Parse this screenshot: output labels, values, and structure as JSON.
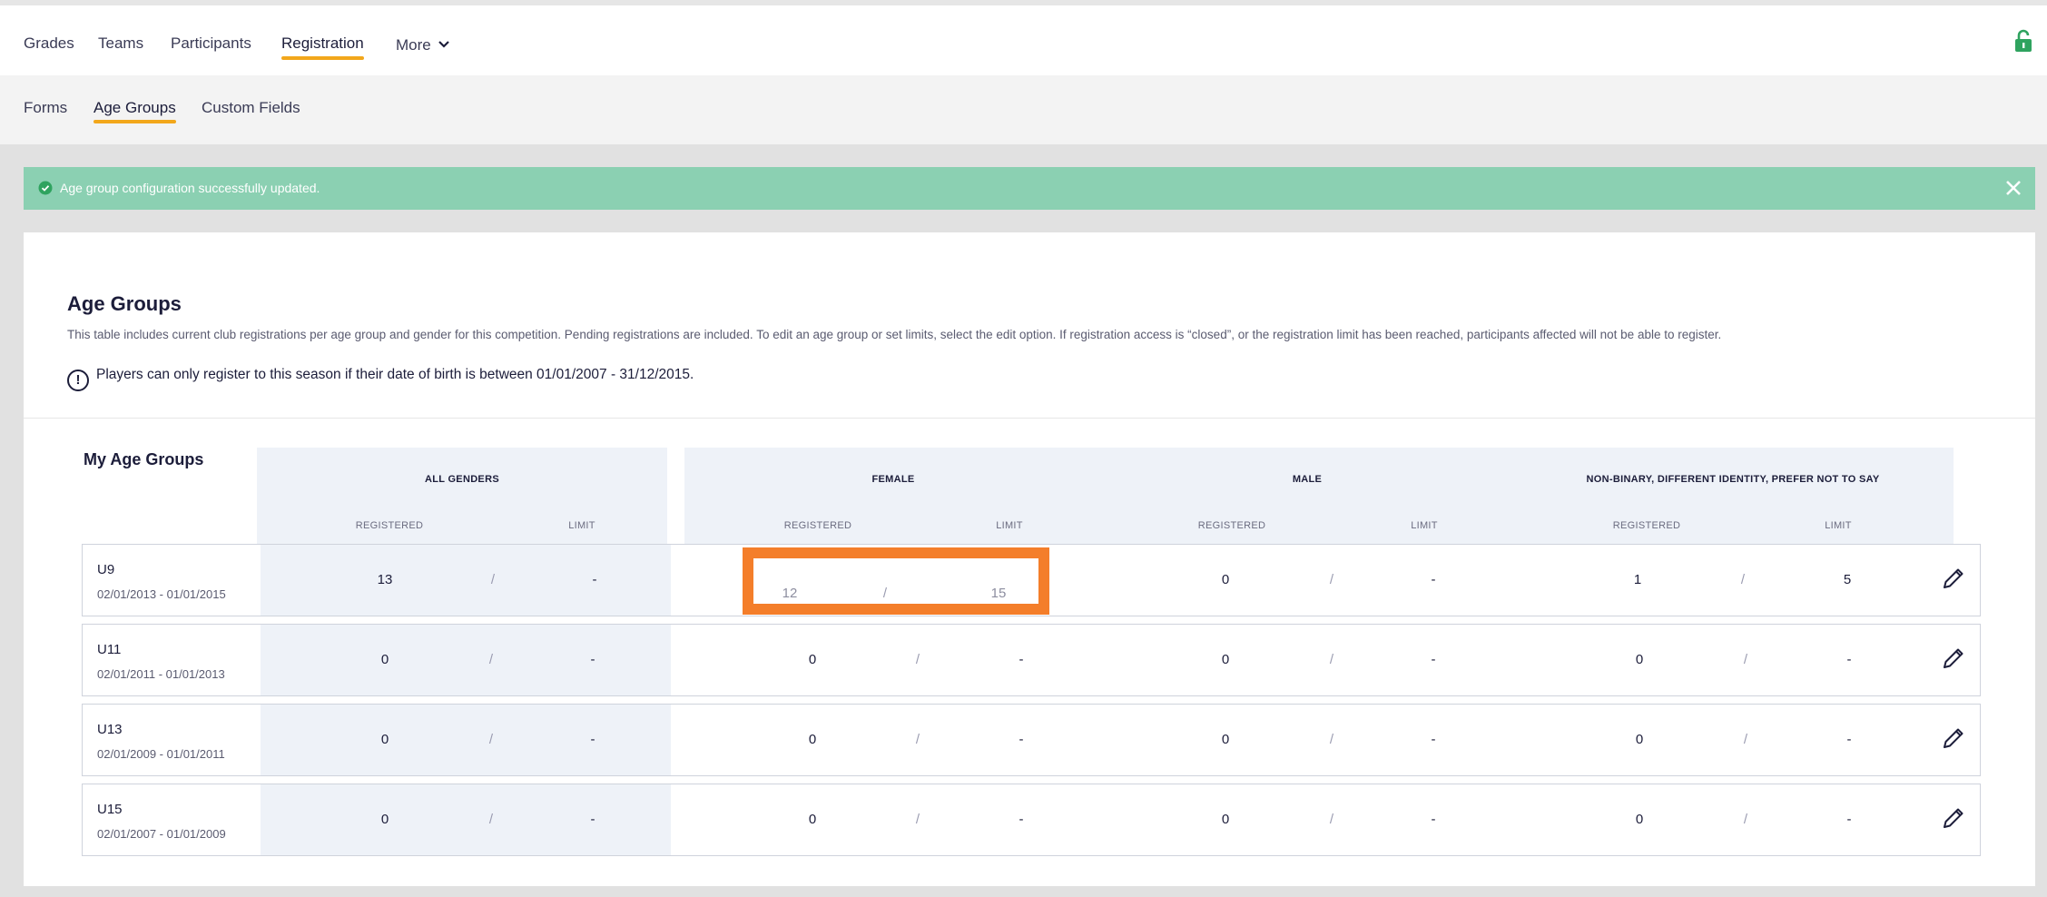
{
  "topnav": {
    "tabs": [
      {
        "label": "Grades"
      },
      {
        "label": "Teams"
      },
      {
        "label": "Participants"
      },
      {
        "label": "Registration",
        "active": true
      },
      {
        "label": "More"
      }
    ],
    "icons": {
      "more": "chevron-down-icon",
      "lock": "lock-icon"
    }
  },
  "subnav": {
    "tabs": [
      {
        "label": "Forms"
      },
      {
        "label": "Age Groups",
        "active": true
      },
      {
        "label": "Custom Fields"
      }
    ]
  },
  "alert": {
    "message": "Age group configuration successfully updated.",
    "icons": {
      "check": "check-circle-icon",
      "close": "close-icon"
    },
    "background": "#8bd0b2"
  },
  "card": {
    "title": "Age Groups",
    "description": "This table includes current club registrations per age group and gender for this competition. Pending registrations are included. To edit an age group or set limits, select the edit option. If registration access is “closed”, or the registration limit has been reached, participants affected will not be able to register.",
    "note": "Players can only register to this season if their date of birth is between 01/01/2007 - 31/12/2015."
  },
  "table": {
    "title": "My Age Groups",
    "groups": [
      "ALL GENDERS",
      "FEMALE",
      "MALE",
      "NON-BINARY, DIFFERENT IDENTITY, PREFER NOT TO SAY"
    ],
    "sub_headers": {
      "registered": "REGISTERED",
      "limit": "LIMIT"
    },
    "separator": "/",
    "rows": [
      {
        "name": "U9",
        "range": "02/01/2013 - 01/01/2015",
        "all": {
          "reg": "13",
          "lim": "-"
        },
        "female": {
          "reg": "12",
          "lim": "15"
        },
        "male": {
          "reg": "0",
          "lim": "-"
        },
        "nb": {
          "reg": "1",
          "lim": "5"
        }
      },
      {
        "name": "U11",
        "range": "02/01/2011 - 01/01/2013",
        "all": {
          "reg": "0",
          "lim": "-"
        },
        "female": {
          "reg": "0",
          "lim": "-"
        },
        "male": {
          "reg": "0",
          "lim": "-"
        },
        "nb": {
          "reg": "0",
          "lim": "-"
        }
      },
      {
        "name": "U13",
        "range": "02/01/2009 - 01/01/2011",
        "all": {
          "reg": "0",
          "lim": "-"
        },
        "female": {
          "reg": "0",
          "lim": "-"
        },
        "male": {
          "reg": "0",
          "lim": "-"
        },
        "nb": {
          "reg": "0",
          "lim": "-"
        }
      },
      {
        "name": "U15",
        "range": "02/01/2007 - 01/01/2009",
        "all": {
          "reg": "0",
          "lim": "-"
        },
        "female": {
          "reg": "0",
          "lim": "-"
        },
        "male": {
          "reg": "0",
          "lim": "-"
        },
        "nb": {
          "reg": "0",
          "lim": "-"
        }
      }
    ],
    "highlight_color": "#f47e2a",
    "accent_color": "#f2a71b"
  }
}
